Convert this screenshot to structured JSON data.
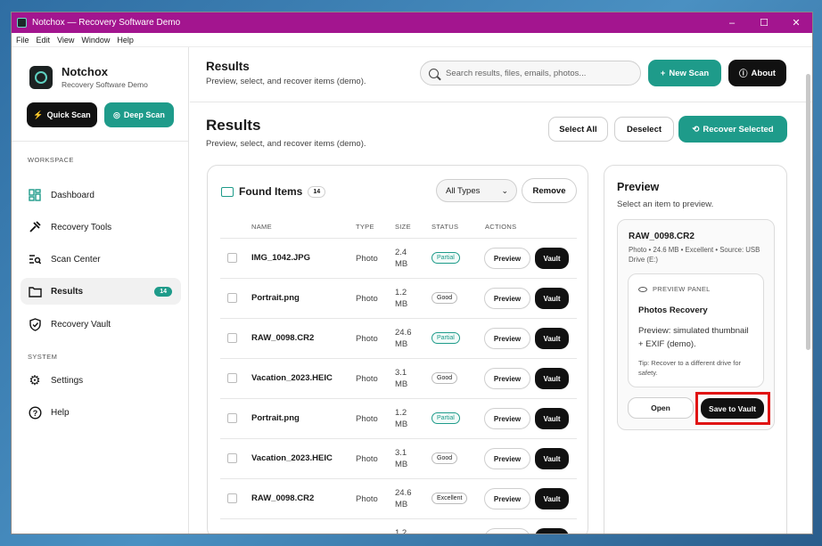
{
  "window": {
    "title": "Notchox — Recovery Software Demo",
    "controls": [
      "–",
      "☐",
      "✕"
    ]
  },
  "menu": [
    "File",
    "Edit",
    "View",
    "Window",
    "Help"
  ],
  "brand": {
    "name": "Notchox",
    "subtitle": "Recovery Software Demo"
  },
  "sidebar": {
    "quick_scan": "Quick Scan",
    "deep_scan": "Deep Scan",
    "workspace_label": "WORKSPACE",
    "system_label": "SYSTEM",
    "items": [
      {
        "label": "Dashboard",
        "icon": "dashboard-icon"
      },
      {
        "label": "Recovery Tools",
        "icon": "tools-icon"
      },
      {
        "label": "Scan Center",
        "icon": "scan-icon"
      },
      {
        "label": "Results",
        "icon": "folder-icon",
        "badge": "14",
        "active": true
      },
      {
        "label": "Recovery Vault",
        "icon": "shield-icon"
      }
    ],
    "system_items": [
      {
        "label": "Settings",
        "icon": "gear-icon"
      },
      {
        "label": "Help",
        "icon": "help-icon"
      }
    ]
  },
  "header": {
    "title": "Results",
    "subtitle": "Preview, select, and recover items (demo).",
    "search_placeholder": "Search results, files, emails, photos...",
    "new_scan": "New Scan",
    "about": "About"
  },
  "page": {
    "title": "Results",
    "subtitle": "Preview, select, and recover items (demo).",
    "select_all": "Select All",
    "deselect": "Deselect",
    "recover_selected": "Recover Selected"
  },
  "found": {
    "title": "Found Items",
    "count": "14",
    "filter": "All Types",
    "remove": "Remove",
    "columns": [
      "NAME",
      "TYPE",
      "SIZE",
      "STATUS",
      "ACTIONS"
    ],
    "preview_label": "Preview",
    "vault_label": "Vault",
    "rows": [
      {
        "name": "IMG_1042.JPG",
        "type": "Photo",
        "size": "2.4 MB",
        "status": "Partial"
      },
      {
        "name": "Portrait.png",
        "type": "Photo",
        "size": "1.2 MB",
        "status": "Good"
      },
      {
        "name": "RAW_0098.CR2",
        "type": "Photo",
        "size": "24.6 MB",
        "status": "Partial"
      },
      {
        "name": "Vacation_2023.HEIC",
        "type": "Photo",
        "size": "3.1 MB",
        "status": "Good"
      },
      {
        "name": "Portrait.png",
        "type": "Photo",
        "size": "1.2 MB",
        "status": "Partial"
      },
      {
        "name": "Vacation_2023.HEIC",
        "type": "Photo",
        "size": "3.1 MB",
        "status": "Good"
      },
      {
        "name": "RAW_0098.CR2",
        "type": "Photo",
        "size": "24.6 MB",
        "status": "Excellent"
      },
      {
        "name": "Portrait.png",
        "type": "Photo",
        "size": "1.2 MB",
        "status": ""
      }
    ]
  },
  "preview": {
    "title": "Preview",
    "subtitle": "Select an item to preview.",
    "file_name": "RAW_0098.CR2",
    "meta": "Photo • 24.6 MB • Excellent • Source: USB Drive (E:)",
    "panel_label": "PREVIEW PANEL",
    "panel_title": "Photos Recovery",
    "panel_desc": "Preview: simulated thumbnail + EXIF (demo).",
    "tip": "Tip: Recover to a different drive for safety.",
    "open": "Open",
    "save": "Save to Vault"
  },
  "colors": {
    "titlebar": "#a3158f",
    "accent": "#1e9b8a",
    "dark": "#111111",
    "highlight": "#e01414"
  }
}
